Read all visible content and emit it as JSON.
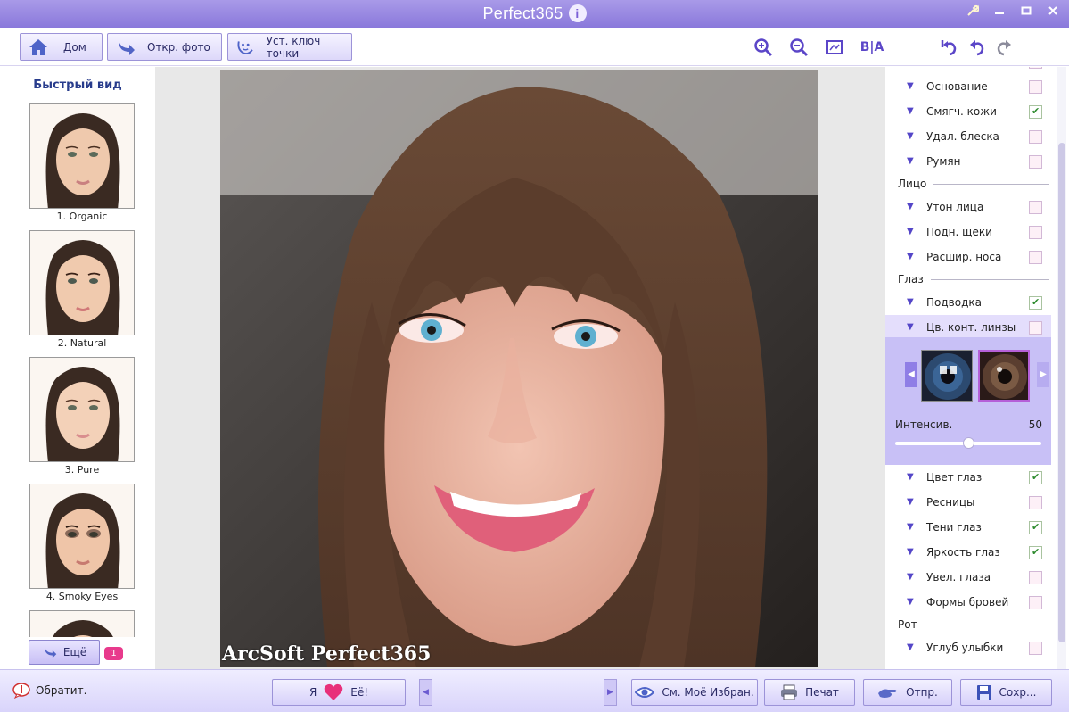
{
  "window": {
    "title": "Perfect365",
    "info_glyph": "i"
  },
  "toolbar": {
    "home_label": "Дом",
    "open_photo_label": "Откр. фото",
    "keypoints_label": "Уст. ключ точки",
    "before_after_label": "B|A",
    "icons": [
      "zoom-in-icon",
      "zoom-out-icon",
      "fit-screen-icon",
      "undo-all-icon",
      "undo-icon",
      "redo-icon"
    ]
  },
  "left_panel": {
    "header": "Быстрый вид",
    "presets": [
      {
        "caption": "1. Organic"
      },
      {
        "caption": "2. Natural"
      },
      {
        "caption": "3. Pure"
      },
      {
        "caption": "4. Smoky Eyes"
      }
    ],
    "more_label": "Ещё",
    "more_badge": "1"
  },
  "photo": {
    "watermark": "ArcSoft Perfect365"
  },
  "right_panel": {
    "items_skin": [
      {
        "label": "Основание",
        "checked": false
      },
      {
        "label": "Смягч. кожи",
        "checked": true
      },
      {
        "label": "Удал. блеска",
        "checked": false
      },
      {
        "label": "Румян",
        "checked": false
      }
    ],
    "section_face": "Лицо",
    "items_face": [
      {
        "label": "Утон лица",
        "checked": false
      },
      {
        "label": "Подн. щеки",
        "checked": false
      },
      {
        "label": "Расшир. носа",
        "checked": false
      }
    ],
    "section_eyes": "Глаз",
    "items_eyes_a": [
      {
        "label": "Подводка",
        "checked": true
      },
      {
        "label": "Цв. конт. линзы",
        "checked": false
      }
    ],
    "lens": {
      "intensity_label": "Интенсив.",
      "intensity_value": "50",
      "intensity_fraction": 0.5
    },
    "items_eyes_b": [
      {
        "label": "Цвет глаз",
        "checked": true
      },
      {
        "label": "Ресницы",
        "checked": false
      },
      {
        "label": "Тени глаз",
        "checked": true
      },
      {
        "label": "Яркость глаз",
        "checked": true
      },
      {
        "label": "Увел. глаза",
        "checked": false
      },
      {
        "label": "Формы бровей",
        "checked": false
      }
    ],
    "section_mouth": "Рот",
    "items_mouth": [
      {
        "label": "Углуб улыбки",
        "checked": false
      }
    ]
  },
  "bottom": {
    "feedback_label": "Обратит.",
    "love_left": "Я",
    "love_right": "Её!",
    "favorites_label": "См. Моё Избран.",
    "print_label": "Печат",
    "send_label": "Отпр.",
    "save_label": "Сохр..."
  },
  "colors": {
    "accent": "#8a78db",
    "check": "#2d8a2d",
    "badge": "#e83a8c"
  }
}
